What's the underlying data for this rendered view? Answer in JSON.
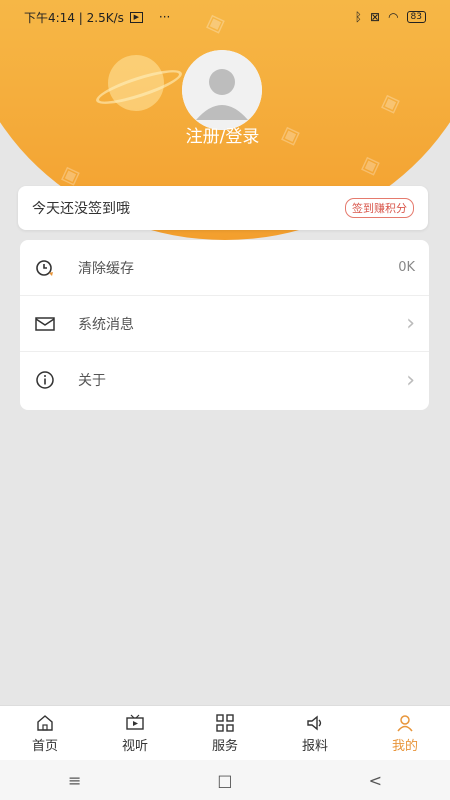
{
  "status_bar": {
    "left_text": "下午4:14 | 2.5K/s",
    "dots": "···",
    "battery": "83"
  },
  "profile": {
    "login_text": "注册/登录"
  },
  "signin": {
    "text": "今天还没签到哦",
    "button": "签到赚积分"
  },
  "menu": {
    "items": [
      {
        "label": "清除缓存",
        "value": "0K",
        "icon": "clean-icon"
      },
      {
        "label": "系统消息",
        "icon": "mail-icon"
      },
      {
        "label": "关于",
        "icon": "info-icon"
      }
    ]
  },
  "tabbar": {
    "tabs": [
      {
        "label": "首页",
        "icon": "home-icon"
      },
      {
        "label": "视听",
        "icon": "video-icon"
      },
      {
        "label": "服务",
        "icon": "grid-icon"
      },
      {
        "label": "报料",
        "icon": "speaker-icon"
      },
      {
        "label": "我的",
        "icon": "user-icon",
        "active": true
      }
    ]
  },
  "system_nav": {
    "menu": "≡",
    "home": "□",
    "back": "<"
  },
  "colors": {
    "accent": "#e8953a",
    "header_top": "#f7c85a",
    "header_bottom": "#f39f2e"
  }
}
